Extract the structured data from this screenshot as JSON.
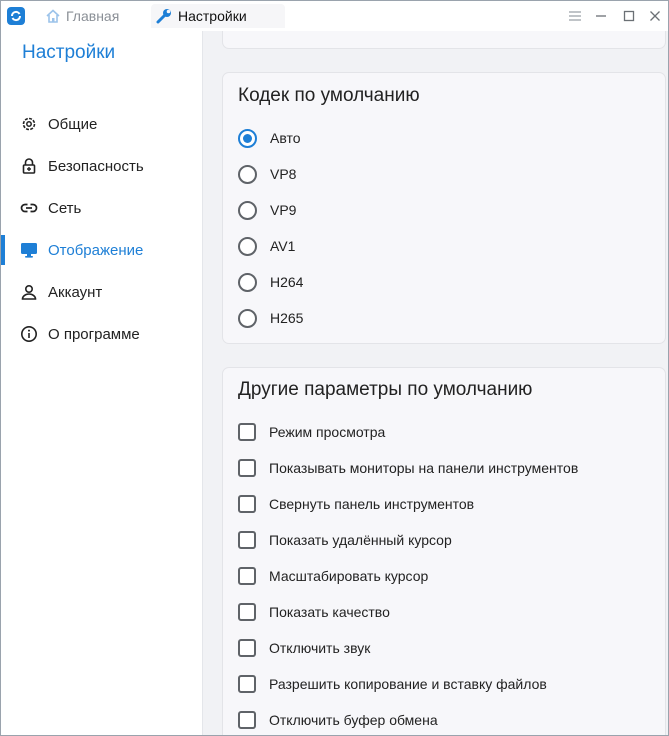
{
  "window": {
    "tabs": [
      {
        "label": "Главная",
        "icon": "home-icon"
      },
      {
        "label": "Настройки",
        "icon": "wrench-icon"
      }
    ]
  },
  "sidebar": {
    "title": "Настройки",
    "items": [
      {
        "label": "Общие",
        "icon": "gear-icon"
      },
      {
        "label": "Безопасность",
        "icon": "lock-icon"
      },
      {
        "label": "Сеть",
        "icon": "link-icon"
      },
      {
        "label": "Отображение",
        "icon": "monitor-icon",
        "active": true
      },
      {
        "label": "Аккаунт",
        "icon": "person-icon"
      },
      {
        "label": "О программе",
        "icon": "info-icon"
      }
    ]
  },
  "codec": {
    "title": "Кодек по умолчанию",
    "options": [
      {
        "label": "Авто",
        "selected": true
      },
      {
        "label": "VP8",
        "selected": false
      },
      {
        "label": "VP9",
        "selected": false
      },
      {
        "label": "AV1",
        "selected": false
      },
      {
        "label": "H264",
        "selected": false
      },
      {
        "label": "H265",
        "selected": false
      }
    ]
  },
  "other": {
    "title": "Другие параметры по умолчанию",
    "options": [
      {
        "label": "Режим просмотра",
        "checked": false
      },
      {
        "label": "Показывать мониторы на панели инструментов",
        "checked": false
      },
      {
        "label": "Свернуть панель инструментов",
        "checked": false
      },
      {
        "label": "Показать удалённый курсор",
        "checked": false
      },
      {
        "label": "Масштабировать курсор",
        "checked": false
      },
      {
        "label": "Показать качество",
        "checked": false
      },
      {
        "label": "Отключить звук",
        "checked": false
      },
      {
        "label": "Разрешить копирование и вставку файлов",
        "checked": false
      },
      {
        "label": "Отключить буфер обмена",
        "checked": false
      }
    ]
  },
  "colors": {
    "accent": "#1e7fd6",
    "content_bg": "#f1f2f5",
    "card_bg": "#f7f7fa"
  }
}
